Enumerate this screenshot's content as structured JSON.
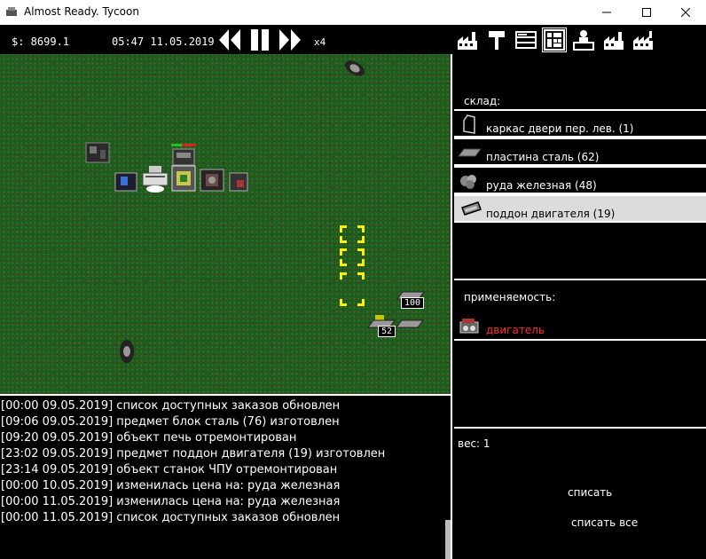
{
  "window": {
    "title": "Almost Ready. Tycoon"
  },
  "hud": {
    "money": "$: 8699.1",
    "clock": "05:47 11.05.2019",
    "speed": "x4"
  },
  "toolbar": {
    "icons": [
      "factory-icon",
      "hammer-icon",
      "storage-icon",
      "warehouse-grid-icon",
      "worker-desk-icon",
      "factory-icon",
      "factory-icon"
    ],
    "active_index": 3
  },
  "map": {
    "bins": [
      {
        "label": "100"
      },
      {
        "label": "52"
      }
    ]
  },
  "log": [
    "[00:00 09.05.2019] список доступных заказов обновлен",
    "[09:06 09.05.2019] предмет блок сталь (76) изготовлен",
    "[09:20 09.05.2019] объект печь отремонтирован",
    "[23:02 09.05.2019] предмет поддон двигателя (19) изготовлен",
    "[23:14 09.05.2019] объект станок ЧПУ отремонтирован",
    "[00:00 10.05.2019] изменилась цена на: руда железная",
    "[00:00 11.05.2019] изменилась цена на: руда железная",
    "[00:00 11.05.2019] список доступных заказов обновлен"
  ],
  "panel": {
    "warehouse_label": "склад:",
    "items": [
      {
        "label": "каркас двери пер. лев. (1)",
        "icon": "door-frame-icon"
      },
      {
        "label": "пластина сталь (62)",
        "icon": "steel-plate-icon"
      },
      {
        "label": "руда железная (48)",
        "icon": "iron-ore-icon"
      },
      {
        "label": "поддон двигателя (19)",
        "icon": "engine-pan-icon"
      }
    ],
    "selected_index": 3,
    "usage_label": "применяемость:",
    "usage_items": [
      {
        "label": "двигатель",
        "icon": "engine-icon",
        "color": "#ff2a2a"
      }
    ],
    "weight_label": "вес: 1",
    "discard_label": "списать",
    "discard_all_label": "списать все"
  }
}
